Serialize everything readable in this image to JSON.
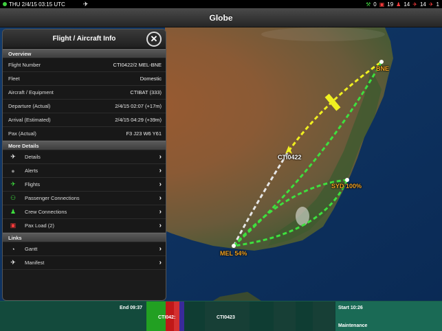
{
  "status_bar": {
    "datetime": "THU 2/4/15 03:15 UTC",
    "counts": [
      "0",
      "19",
      "14",
      "14",
      "1"
    ]
  },
  "title": "Globe",
  "panel": {
    "title": "Flight / Aircraft Info",
    "overview_header": "Overview",
    "overview": [
      {
        "label": "Flight Number",
        "value": "CTI0422/2 MEL-BNE"
      },
      {
        "label": "Fleet",
        "value": "Domestic"
      },
      {
        "label": "Aircraft / Equipment",
        "value": "CTIBAT (333)"
      },
      {
        "label": "Departure (Actual)",
        "value": "2/4/15 02:07 (+17m)"
      },
      {
        "label": "Arrival (Estimated)",
        "value": "2/4/15 04:29 (+39m)"
      },
      {
        "label": "Pax (Actual)",
        "value": "F3 J23 W6 Y61"
      }
    ],
    "details_header": "More Details",
    "details": [
      {
        "label": "Details",
        "icon": "airplane-icon"
      },
      {
        "label": "Alerts",
        "icon": "alert-icon"
      },
      {
        "label": "Flights",
        "icon": "airplane-icon"
      },
      {
        "label": "Passenger Connections",
        "icon": "people-icon"
      },
      {
        "label": "Crew Connections",
        "icon": "crew-icon"
      },
      {
        "label": "Pax Load (2)",
        "icon": "pax-load-icon"
      }
    ],
    "links_header": "Links",
    "links": [
      {
        "label": "Gantt",
        "icon": "gauge-icon"
      },
      {
        "label": "Manifest",
        "icon": "airplane-icon"
      }
    ]
  },
  "map": {
    "labels": {
      "bne": "BNE",
      "syd": "SYD 100%",
      "mel": "MEL 54%",
      "flight": "CTI0422"
    },
    "colors": {
      "route_green": "#3ee03e",
      "route_yellow": "#f0f020",
      "route_white": "#e6e6e6",
      "label_orange": "#f0a020"
    }
  },
  "timeline": {
    "end": "End 09:37",
    "start": "Start 10:26",
    "block1": "CTI042:",
    "block2": "CTI0423",
    "maintenance": "Maintenance"
  }
}
